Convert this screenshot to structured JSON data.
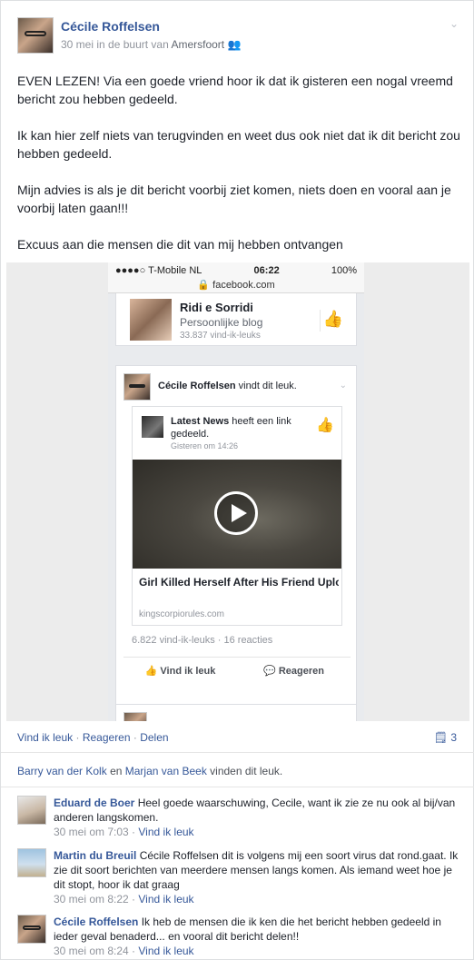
{
  "post": {
    "author": "Cécile Roffelsen",
    "date": "30 mei",
    "location_prefix": "in de buurt van",
    "location": "Amersfoort",
    "paragraphs": [
      "EVEN LEZEN! Via een goede vriend hoor ik dat ik gisteren een nogal vreemd bericht zou hebben gedeeld.",
      "Ik kan hier zelf niets van terugvinden en weet dus ook niet dat ik dit bericht zou hebben gedeeld.",
      "Mijn advies is als je dit bericht voorbij ziet komen, niets doen en vooral aan je voorbij laten gaan!!!",
      "Excuus aan die mensen die dit van mij hebben ontvangen"
    ]
  },
  "screenshot": {
    "status": {
      "signal": "●●●●○ T-Mobile NL",
      "time": "06:22",
      "battery": "100%"
    },
    "url": "facebook.com",
    "blog": {
      "name": "Ridi e Sorridi",
      "type": "Persoonlijke blog",
      "likes": "33.837 vind-ik-leuks"
    },
    "shared": {
      "actor": "Cécile Roffelsen",
      "action": "vindt dit leuk.",
      "source": "Latest News",
      "source_action": "heeft een link gedeeld.",
      "time": "Gisteren om 14:26",
      "video_title": "Girl Killed Herself After His Friend Uploaed Her This School Bathroo...",
      "video_site": "kingscorpiorules.com",
      "stats": "6.822 vind-ik-leuks · 16 reacties",
      "like_label": "Vind ik leuk",
      "comment_label": "Reageren"
    }
  },
  "actions": {
    "like": "Vind ik leuk",
    "comment": "Reageren",
    "share": "Delen",
    "comment_count": "3"
  },
  "likes_summary": {
    "person1": "Barry van der Kolk",
    "joiner": "en",
    "person2": "Marjan van Beek",
    "suffix": "vinden dit leuk."
  },
  "comments": [
    {
      "name": "Eduard de Boer",
      "text": "Heel goede waarschuwing, Cecile, want ik zie ze nu ook al bij/van anderen langskomen.",
      "time": "30 mei om 7:03",
      "like": "Vind ik leuk"
    },
    {
      "name": "Martin du Breuil",
      "text": "Cécile Roffelsen dit is volgens mij een soort virus dat rond.gaat. Ik zie dit soort berichten van meerdere mensen langs komen. Als iemand weet hoe je dit stopt, hoor ik dat graag",
      "time": "30 mei om 8:22",
      "like": "Vind ik leuk"
    },
    {
      "name": "Cécile Roffelsen",
      "text": "Ik heb de mensen die ik ken die het bericht hebben gedeeld in ieder geval benaderd... en vooral dit bericht delen!!",
      "time": "30 mei om 8:24",
      "like": "Vind ik leuk"
    }
  ]
}
